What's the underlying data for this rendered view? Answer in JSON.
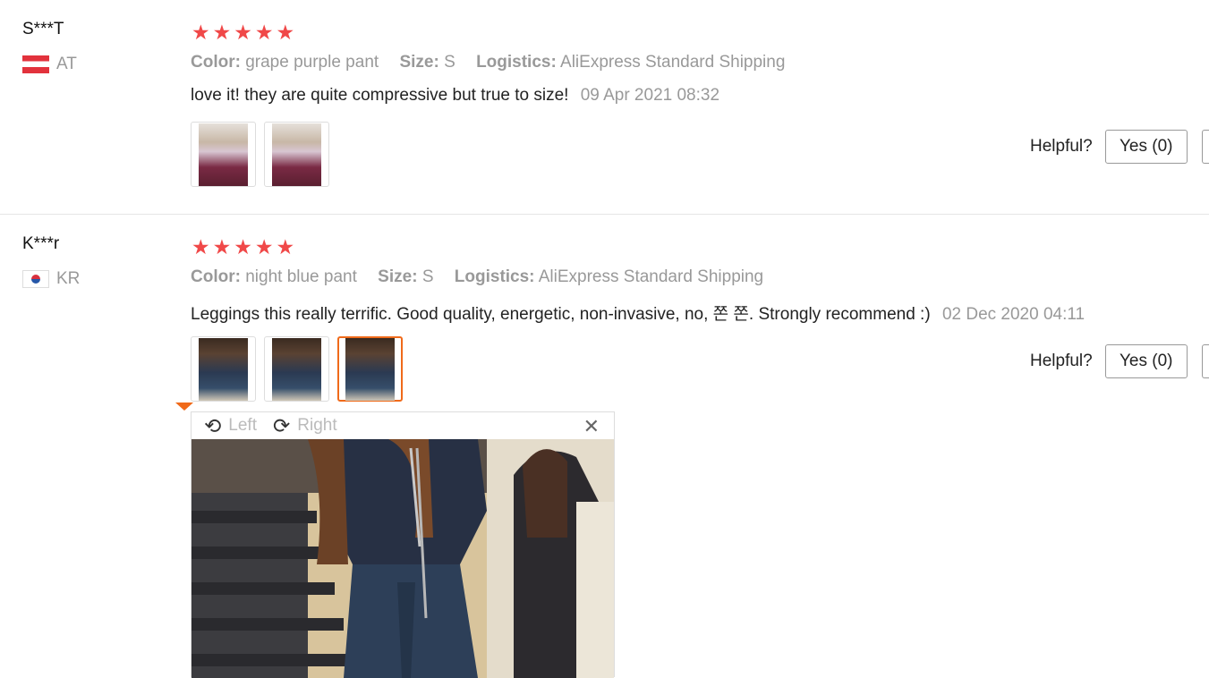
{
  "labels": {
    "color": "Color:",
    "size": "Size:",
    "logistics": "Logistics:",
    "helpful": "Helpful?",
    "yes": "Yes (0)"
  },
  "reviews": [
    {
      "user": "S***T",
      "country_code": "AT",
      "rating": 5,
      "color": "grape purple pant",
      "size": "S",
      "logistics": "AliExpress Standard Shipping",
      "text": "love it! they are quite compressive but true to size!",
      "date": "09 Apr 2021 08:32",
      "photo_count": 2
    },
    {
      "user": "K***r",
      "country_code": "KR",
      "rating": 5,
      "color": "night blue pant",
      "size": "S",
      "logistics": "AliExpress Standard Shipping",
      "text": "Leggings this really terrific. Good quality, energetic, non-invasive, no, 쫀 쫀. Strongly recommend :)",
      "date": "02 Dec 2020 04:11",
      "photo_count": 3,
      "selected_photo": 3
    }
  ],
  "viewer": {
    "rotate_left": "Left",
    "rotate_right": "Right",
    "close_icon": "close-icon",
    "rotate_left_icon": "rotate-left-icon",
    "rotate_right_icon": "rotate-right-icon"
  },
  "colors": {
    "star": "#f04848",
    "selected_border": "#f06a1a",
    "muted_text": "#999999"
  }
}
